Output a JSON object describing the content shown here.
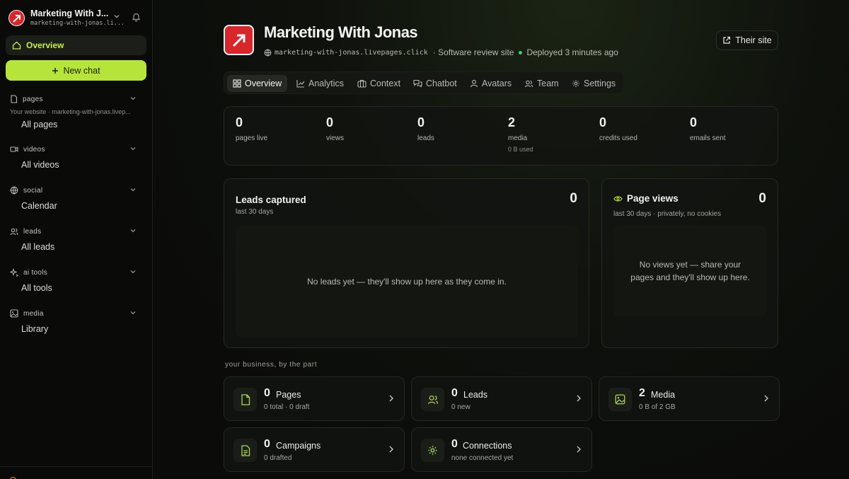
{
  "workspace": {
    "title": "Marketing With J...",
    "url": "marketing-with-jonas.li..."
  },
  "nav": {
    "overview": "Overview",
    "new_chat": "New chat"
  },
  "sidebar": {
    "pages": {
      "title": "pages",
      "sub": "Your website · marketing-with-jonas.livep...",
      "item": "All pages"
    },
    "videos": {
      "title": "videos",
      "item": "All videos"
    },
    "social": {
      "title": "social",
      "item": "Calendar"
    },
    "leads": {
      "title": "leads",
      "item": "All leads"
    },
    "ai_tools": {
      "title": "ai tools",
      "item": "All tools"
    },
    "media": {
      "title": "media",
      "item": "Library"
    }
  },
  "site": {
    "title": "Marketing With Jonas",
    "domain": "marketing-with-jonas.livepages.click",
    "type": "· Software review site",
    "status": "Deployed 3 minutes ago",
    "their_site": "Their site"
  },
  "tabs": [
    "Overview",
    "Analytics",
    "Context",
    "Chatbot",
    "Avatars",
    "Team",
    "Settings"
  ],
  "stats": [
    {
      "value": "0",
      "label": "pages live",
      "sub": ""
    },
    {
      "value": "0",
      "label": "views",
      "sub": ""
    },
    {
      "value": "0",
      "label": "leads",
      "sub": ""
    },
    {
      "value": "2",
      "label": "media",
      "sub": "0 B used"
    },
    {
      "value": "0",
      "label": "credits used",
      "sub": ""
    },
    {
      "value": "0",
      "label": "emails sent",
      "sub": ""
    }
  ],
  "leads_panel": {
    "title": "Leads captured",
    "sub": "last 30 days",
    "value": "0",
    "empty": "No leads yet — they'll show up here as they come in."
  },
  "views_panel": {
    "title": "Page views",
    "sub": "last 30 days · privately, no cookies",
    "value": "0",
    "empty": "No views yet — share your pages and they'll show up here."
  },
  "business": {
    "heading": "your business, by the part",
    "tiles": [
      {
        "num": "0",
        "label": "Pages",
        "sub": "0 total · 0 draft",
        "icon": "file-icon"
      },
      {
        "num": "0",
        "label": "Leads",
        "sub": "0 new",
        "icon": "users-icon"
      },
      {
        "num": "2",
        "label": "Media",
        "sub": "0 B of 2 GB",
        "icon": "image-icon"
      },
      {
        "num": "0",
        "label": "Campaigns",
        "sub": "0 drafted",
        "icon": "document-icon"
      },
      {
        "num": "0",
        "label": "Connections",
        "sub": "none connected yet",
        "icon": "gear-icon"
      }
    ]
  },
  "colors": {
    "accent": "#b7e43a",
    "brand_red": "#d8262a",
    "status_green": "#3fd26b"
  }
}
